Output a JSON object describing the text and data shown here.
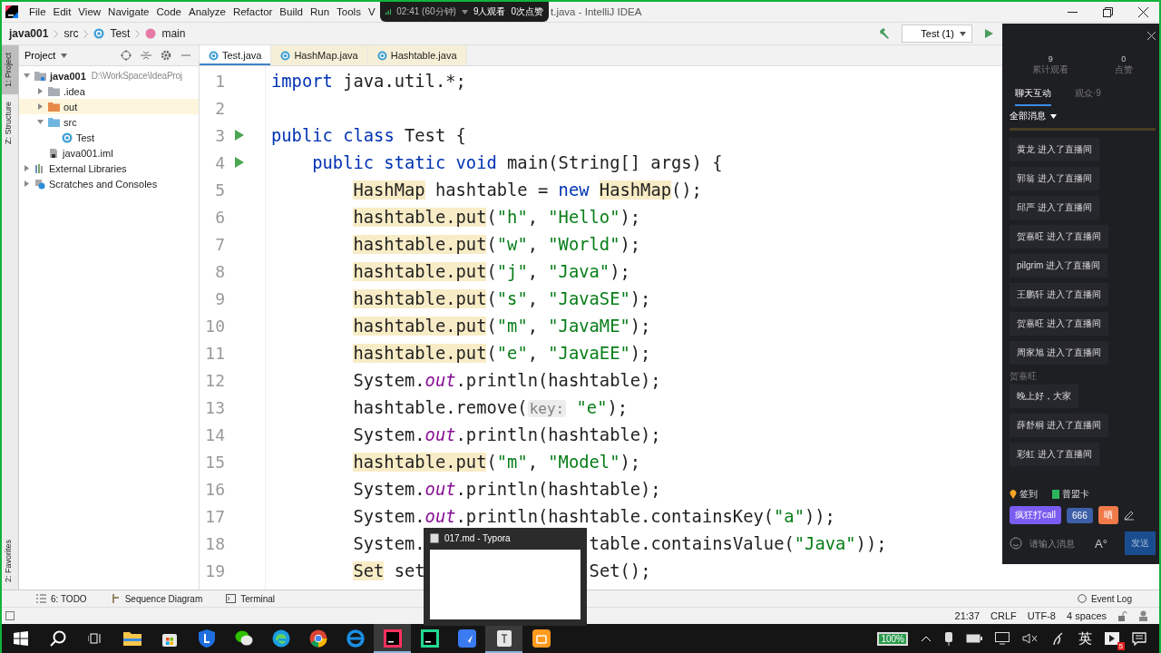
{
  "menu": [
    "File",
    "Edit",
    "View",
    "Navigate",
    "Code",
    "Analyze",
    "Refactor",
    "Build",
    "Run",
    "Tools",
    "V"
  ],
  "window_title": "t.java - IntelliJ IDEA",
  "live_overlay": {
    "time": "02:41 (60分钟)",
    "viewers": "9人观看",
    "likes": "0次点赞"
  },
  "breadcrumbs": [
    {
      "label": "java001",
      "kind": "project"
    },
    {
      "label": "src",
      "kind": "folder"
    },
    {
      "label": "Test",
      "kind": "class"
    },
    {
      "label": "main",
      "kind": "method"
    }
  ],
  "run_config": "Test (1)",
  "left_stripe": {
    "top": [
      {
        "label": "1: Project",
        "selected": true
      },
      {
        "label": "Z: Structure",
        "selected": false
      }
    ],
    "bottom": [
      {
        "label": "2: Favorites",
        "selected": false
      }
    ]
  },
  "project_panel": {
    "title": "Project",
    "tree": [
      {
        "label": "java001",
        "path": "D:\\WorkSpace\\IdeaProj",
        "kind": "module",
        "expanded": true,
        "selected": false,
        "children": [
          {
            "label": ".idea",
            "kind": "folder",
            "expanded": false,
            "selected": false
          },
          {
            "label": "out",
            "kind": "excluded",
            "expanded": false,
            "selected": true
          },
          {
            "label": "src",
            "kind": "source",
            "expanded": true,
            "selected": false,
            "children": [
              {
                "label": "Test",
                "kind": "class",
                "selected": false
              }
            ]
          },
          {
            "label": "java001.iml",
            "kind": "iml",
            "selected": false
          }
        ]
      },
      {
        "label": "External Libraries",
        "kind": "libraries",
        "expanded": false,
        "selected": false
      },
      {
        "label": "Scratches and Consoles",
        "kind": "scratches",
        "expanded": false,
        "selected": false
      }
    ]
  },
  "tabs": [
    {
      "label": "Test.java",
      "selected": true
    },
    {
      "label": "HashMap.java",
      "selected": false
    },
    {
      "label": "Hashtable.java",
      "selected": false
    }
  ],
  "code": [
    {
      "num": "1",
      "tokens": [
        {
          "kind": "keyword",
          "text": "import "
        },
        {
          "kind": "plain",
          "text": "java.util.*;"
        }
      ]
    },
    {
      "num": "2"
    },
    {
      "num": "3",
      "run": true,
      "tokens": [
        {
          "kind": "keyword",
          "text": "public class "
        },
        {
          "kind": "plain",
          "text": "Test {"
        }
      ],
      "children": [
        {
          "num": "4",
          "run": true,
          "tokens": [
            {
              "kind": "keyword",
              "text": "public static void "
            },
            {
              "kind": "plain",
              "text": "main(String[] args) {"
            }
          ],
          "children": [
            {
              "num": "5",
              "tokens": [
                {
                  "kind": "highlight",
                  "text": "HashMap"
                },
                {
                  "kind": "plain",
                  "text": " hashtable = "
                },
                {
                  "kind": "keyword",
                  "text": "new "
                },
                {
                  "kind": "highlight",
                  "text": "HashMap"
                },
                {
                  "kind": "plain",
                  "text": "();"
                }
              ]
            },
            {
              "num": "6",
              "tokens": [
                {
                  "kind": "highlight",
                  "text": "hashtable.put"
                },
                {
                  "kind": "plain",
                  "text": "("
                },
                {
                  "kind": "string",
                  "text": "\"h\""
                },
                {
                  "kind": "plain",
                  "text": ", "
                },
                {
                  "kind": "string",
                  "text": "\"Hello\""
                },
                {
                  "kind": "plain",
                  "text": ");"
                }
              ]
            },
            {
              "num": "7",
              "tokens": [
                {
                  "kind": "highlight",
                  "text": "hashtable.put"
                },
                {
                  "kind": "plain",
                  "text": "("
                },
                {
                  "kind": "string",
                  "text": "\"w\""
                },
                {
                  "kind": "plain",
                  "text": ", "
                },
                {
                  "kind": "string",
                  "text": "\"World\""
                },
                {
                  "kind": "plain",
                  "text": ");"
                }
              ]
            },
            {
              "num": "8",
              "tokens": [
                {
                  "kind": "highlight",
                  "text": "hashtable.put"
                },
                {
                  "kind": "plain",
                  "text": "("
                },
                {
                  "kind": "string",
                  "text": "\"j\""
                },
                {
                  "kind": "plain",
                  "text": ", "
                },
                {
                  "kind": "string",
                  "text": "\"Java\""
                },
                {
                  "kind": "plain",
                  "text": ");"
                }
              ]
            },
            {
              "num": "9",
              "tokens": [
                {
                  "kind": "highlight",
                  "text": "hashtable.put"
                },
                {
                  "kind": "plain",
                  "text": "("
                },
                {
                  "kind": "string",
                  "text": "\"s\""
                },
                {
                  "kind": "plain",
                  "text": ", "
                },
                {
                  "kind": "string",
                  "text": "\"JavaSE\""
                },
                {
                  "kind": "plain",
                  "text": ");"
                }
              ]
            },
            {
              "num": "10",
              "tokens": [
                {
                  "kind": "highlight",
                  "text": "hashtable.put"
                },
                {
                  "kind": "plain",
                  "text": "("
                },
                {
                  "kind": "string",
                  "text": "\"m\""
                },
                {
                  "kind": "plain",
                  "text": ", "
                },
                {
                  "kind": "string",
                  "text": "\"JavaME\""
                },
                {
                  "kind": "plain",
                  "text": ");"
                }
              ]
            },
            {
              "num": "11",
              "tokens": [
                {
                  "kind": "highlight",
                  "text": "hashtable.put"
                },
                {
                  "kind": "plain",
                  "text": "("
                },
                {
                  "kind": "string",
                  "text": "\"e\""
                },
                {
                  "kind": "plain",
                  "text": ", "
                },
                {
                  "kind": "string",
                  "text": "\"JavaEE\""
                },
                {
                  "kind": "plain",
                  "text": ");"
                }
              ]
            },
            {
              "num": "12",
              "tokens": [
                {
                  "kind": "plain",
                  "text": "System."
                },
                {
                  "kind": "field",
                  "text": "out"
                },
                {
                  "kind": "plain",
                  "text": ".println(hashtable);"
                }
              ]
            },
            {
              "num": "13",
              "tokens": [
                {
                  "kind": "plain",
                  "text": "hashtable.remove("
                },
                {
                  "kind": "hint",
                  "text": "key:"
                },
                {
                  "kind": "string",
                  "text": " \"e\""
                },
                {
                  "kind": "plain",
                  "text": ");"
                }
              ]
            },
            {
              "num": "14",
              "tokens": [
                {
                  "kind": "plain",
                  "text": "System."
                },
                {
                  "kind": "field",
                  "text": "out"
                },
                {
                  "kind": "plain",
                  "text": ".println(hashtable);"
                }
              ]
            },
            {
              "num": "15",
              "tokens": [
                {
                  "kind": "highlight",
                  "text": "hashtable.put"
                },
                {
                  "kind": "plain",
                  "text": "("
                },
                {
                  "kind": "string",
                  "text": "\"m\""
                },
                {
                  "kind": "plain",
                  "text": ", "
                },
                {
                  "kind": "string",
                  "text": "\"Model\""
                },
                {
                  "kind": "plain",
                  "text": ");"
                }
              ]
            },
            {
              "num": "16",
              "tokens": [
                {
                  "kind": "plain",
                  "text": "System."
                },
                {
                  "kind": "field",
                  "text": "out"
                },
                {
                  "kind": "plain",
                  "text": ".println(hashtable);"
                }
              ]
            },
            {
              "num": "17",
              "tokens": [
                {
                  "kind": "plain",
                  "text": "System."
                },
                {
                  "kind": "field",
                  "text": "out"
                },
                {
                  "kind": "plain",
                  "text": ".println(hashtable.containsKey("
                },
                {
                  "kind": "string",
                  "text": "\"a\""
                },
                {
                  "kind": "plain",
                  "text": "));"
                }
              ]
            },
            {
              "num": "18",
              "tokens": [
                {
                  "kind": "plain",
                  "text": "System."
                }
              ],
              "tail": [
                {
                  "kind": "plain",
                  "text": "table.containsValue("
                },
                {
                  "kind": "string",
                  "text": "\"Java\""
                },
                {
                  "kind": "plain",
                  "text": "));"
                }
              ]
            },
            {
              "num": "19",
              "tokens": [
                {
                  "kind": "highlight",
                  "text": "Set"
                },
                {
                  "kind": "plain",
                  "text": " set"
                }
              ],
              "tail": [
                {
                  "kind": "plain",
                  "text": "Set();"
                }
              ]
            }
          ]
        }
      ]
    }
  ],
  "bottom_tools": [
    {
      "label": "6: TODO",
      "kind": "todo"
    },
    {
      "label": "Sequence Diagram",
      "kind": "sequence"
    },
    {
      "label": "Terminal",
      "kind": "terminal"
    }
  ],
  "event_log": "Event Log",
  "status": [
    "21:37",
    "CRLF",
    "UTF-8",
    "4 spaces"
  ],
  "live_panel": {
    "stats": [
      {
        "value": "9",
        "label": "累计观看"
      },
      {
        "value": "0",
        "label": "点赞"
      }
    ],
    "tabs": [
      {
        "label": "聊天互动",
        "selected": true
      },
      {
        "label": "观众·9",
        "selected": false
      }
    ],
    "filter": "全部消息",
    "messages": [
      {
        "kind": "entry",
        "text": "黄龙 进入了直播间"
      },
      {
        "kind": "entry",
        "text": "郭翁 进入了直播间"
      },
      {
        "kind": "entry",
        "text": "邱严 进入了直播间"
      },
      {
        "kind": "entry",
        "text": "贺嘉旺 进入了直播间"
      },
      {
        "kind": "entry",
        "text": "pilgrim 进入了直播间"
      },
      {
        "kind": "entry",
        "text": "王鹏轩 进入了直播间"
      },
      {
        "kind": "entry",
        "text": "贺嘉旺 进入了直播间"
      },
      {
        "kind": "entry",
        "text": "周家旭 进入了直播间"
      },
      {
        "kind": "chat",
        "sender": "贺嘉旺",
        "text": "晚上好，大家"
      },
      {
        "kind": "entry",
        "text": "薛舒桐 进入了直播间"
      },
      {
        "kind": "entry",
        "text": "彩虹 进入了直播间"
      }
    ],
    "actions": [
      "签到",
      "普盟卡"
    ],
    "gifts": [
      "疯狂打call",
      "666",
      "晒"
    ],
    "input_placeholder": "请输入消息",
    "font_button": "A°",
    "send": "发送"
  },
  "popup": {
    "title": "017.md - Typora"
  },
  "taskbar": [
    {
      "kind": "start",
      "active": false
    },
    {
      "kind": "search",
      "active": false
    },
    {
      "kind": "taskview",
      "active": false
    },
    {
      "kind": "explorer",
      "active": false
    },
    {
      "kind": "store",
      "active": false
    },
    {
      "kind": "shield",
      "active": false
    },
    {
      "kind": "wechat",
      "active": false
    },
    {
      "kind": "edge",
      "active": false
    },
    {
      "kind": "chrome",
      "active": false
    },
    {
      "kind": "ie",
      "active": false
    },
    {
      "kind": "intellij",
      "active": true
    },
    {
      "kind": "datagrip",
      "active": false
    },
    {
      "kind": "feishu",
      "active": false
    },
    {
      "kind": "typora",
      "active": true
    },
    {
      "kind": "orange",
      "active": false
    }
  ],
  "tray": {
    "battery": "100%",
    "ime": "英",
    "badge": "5"
  }
}
